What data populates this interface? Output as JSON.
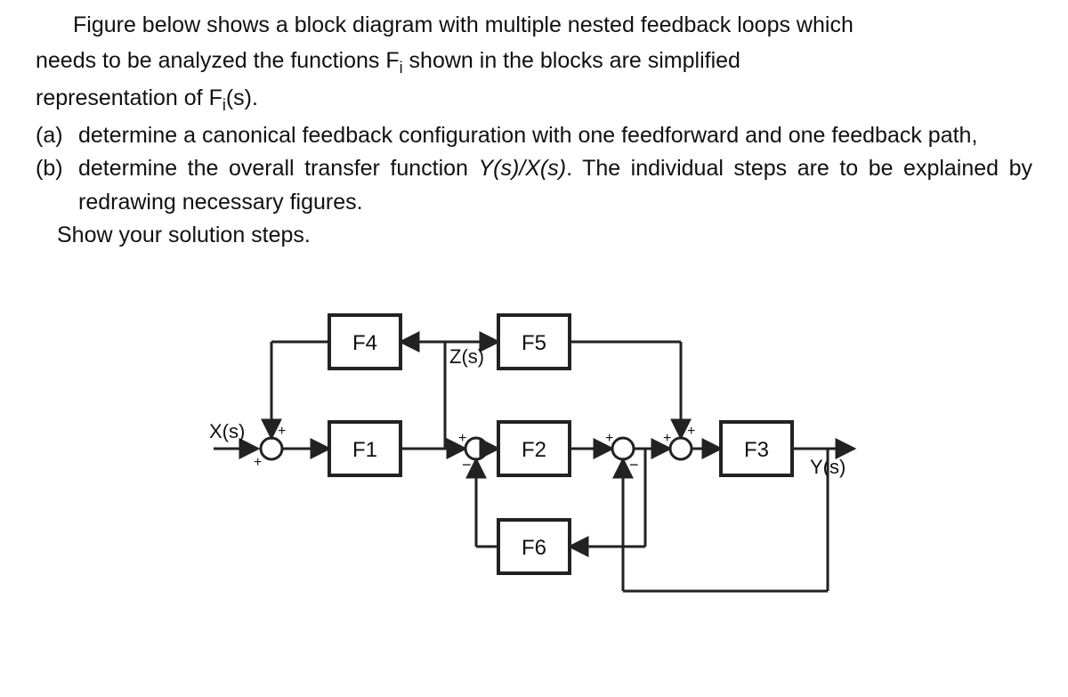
{
  "paragraph": {
    "line1_a": "Figure below shows a block diagram with multiple nested feedback loops which",
    "line2_a": "needs to be analyzed the functions F",
    "line2_sub": "i",
    "line2_b": " shown in the blocks are simplified",
    "line3_a": "representation of F",
    "line3_sub": "i",
    "line3_b": "(s)."
  },
  "items": {
    "a_label": "(a)",
    "a_text": "determine a canonical feedback configuration with one feedforward and one feedback path,",
    "b_label": "(b)",
    "b_text_a": "determine the overall transfer function ",
    "b_text_i": "Y(s)/X(s)",
    "b_text_b": ". The individual steps are to be explained by redrawing necessary figures."
  },
  "show": "Show  your solution steps.",
  "diagram": {
    "input": "X(s)",
    "output": "Y(s)",
    "mid": "Z(s)",
    "blocks": {
      "f1": "F1",
      "f2": "F2",
      "f3": "F3",
      "f4": "F4",
      "f5": "F5",
      "f6": "F6"
    },
    "signs": {
      "s1_top": "+",
      "s1_bot": "+",
      "s2_top": "+",
      "s2_bot": "−",
      "s3_top": "+",
      "s3_bot": "−",
      "s4_top": "+",
      "s4_bot": "+"
    }
  }
}
